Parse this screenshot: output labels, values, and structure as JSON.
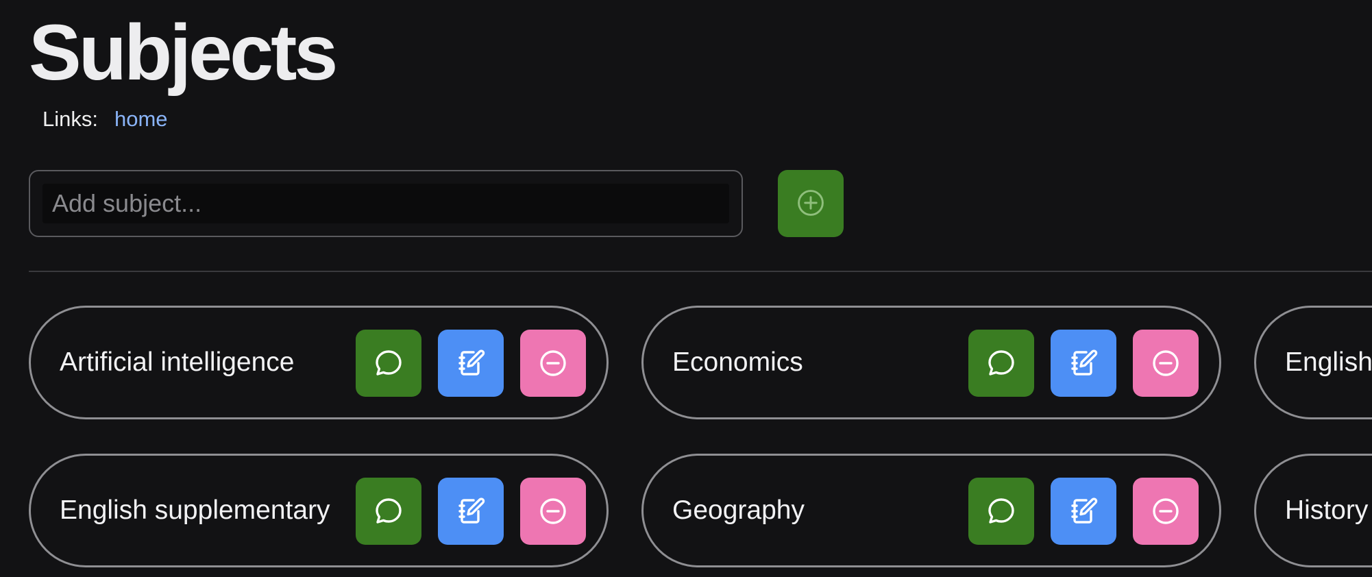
{
  "page": {
    "title": "Subjects"
  },
  "links": {
    "label": "Links:",
    "items": [
      {
        "label": "home"
      }
    ]
  },
  "add_form": {
    "placeholder": "Add subject...",
    "button_icon": "plus-circle-icon"
  },
  "colors": {
    "background": "#121214",
    "chat_button": "#3a7d22",
    "notes_button": "#4d8ff5",
    "remove_button": "#ee76b2",
    "link": "#8ab4f8"
  },
  "subjects": [
    {
      "name": "Artificial intelligence"
    },
    {
      "name": "Economics"
    },
    {
      "name": "English"
    },
    {
      "name": "English supplementary"
    },
    {
      "name": "Geography"
    },
    {
      "name": "History"
    }
  ],
  "card_actions": [
    {
      "name": "chat",
      "icon": "chat-bubble-icon"
    },
    {
      "name": "notes",
      "icon": "notebook-edit-icon"
    },
    {
      "name": "remove",
      "icon": "minus-circle-icon"
    }
  ]
}
